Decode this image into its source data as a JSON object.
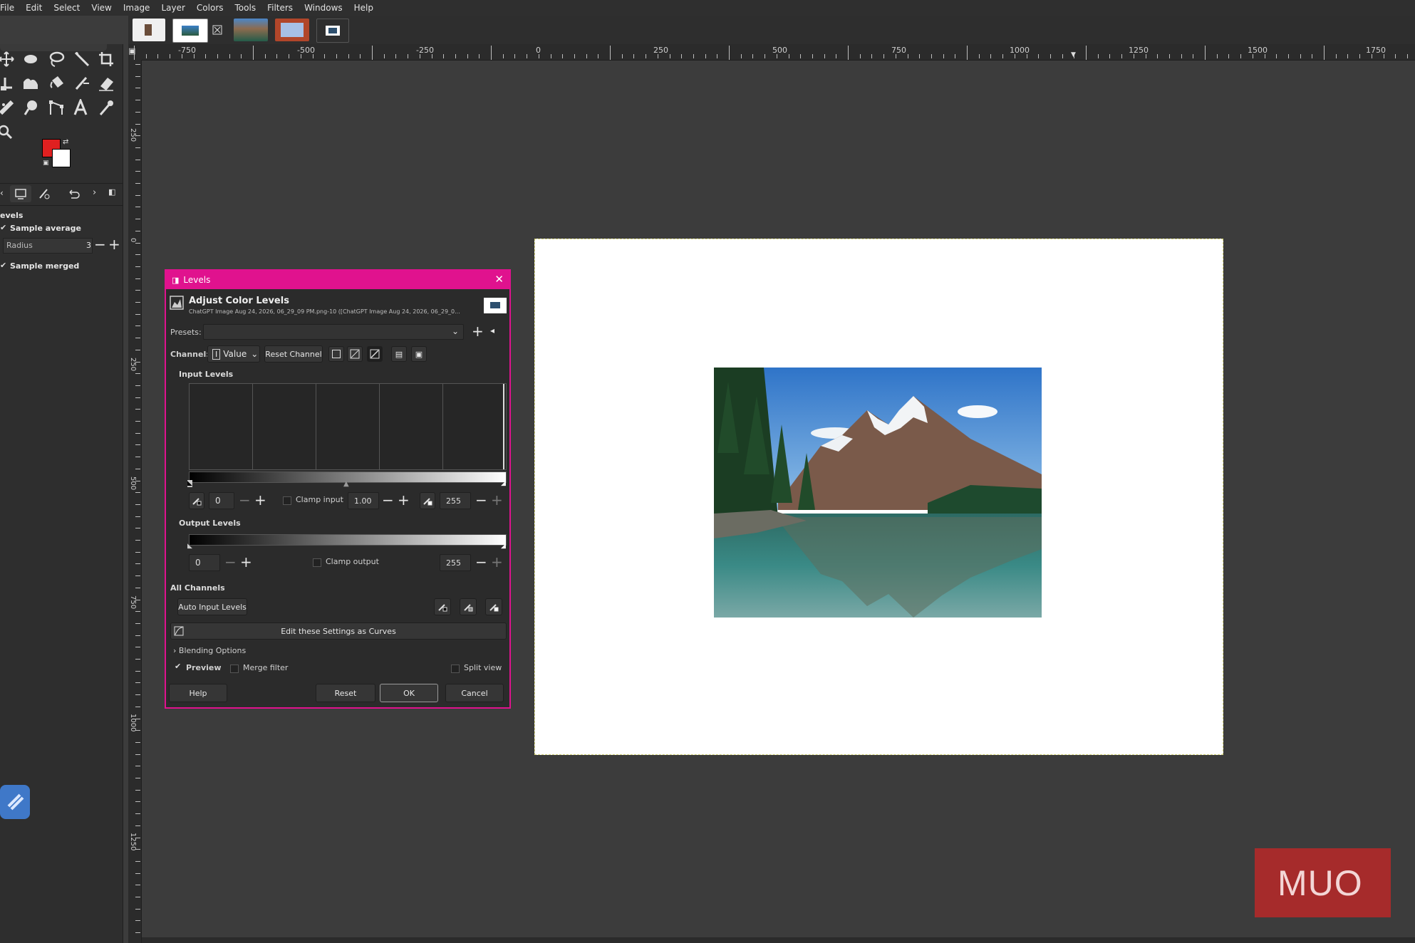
{
  "menu": [
    "File",
    "Edit",
    "Select",
    "View",
    "Image",
    "Layer",
    "Colors",
    "Tools",
    "Filters",
    "Windows",
    "Help"
  ],
  "image_tabs": [
    {
      "icon": "portrait-thumbnail-icon"
    },
    {
      "icon": "landscape-thumbnail-icon",
      "active": true
    },
    {
      "icon": "close-tab-icon"
    },
    {
      "icon": "mountain-lake-thumbnail-icon"
    },
    {
      "icon": "wide-thumbnail-icon"
    },
    {
      "icon": "small-thumbnail-icon"
    }
  ],
  "ruler": {
    "h_labels": [
      "-750",
      "-500",
      "-250",
      "0",
      "250",
      "500",
      "750",
      "1000",
      "1250",
      "1500",
      "1750"
    ],
    "v_labels": [
      "250",
      "0",
      "250",
      "500",
      "750",
      "1000",
      "1250"
    ]
  },
  "tool_options": {
    "title": "evels",
    "sample_average": "Sample average",
    "radius_label": "Radius",
    "radius_value": "3",
    "sample_merged": "Sample merged"
  },
  "colors": {
    "fg": "#e02020",
    "bg": "#ffffff",
    "accent": "#e0128e"
  },
  "dialog": {
    "window_title": "Levels",
    "heading": "Adjust Color Levels",
    "subtitle": "ChatGPT Image Aug 24, 2026, 06_29_09 PM.png-10 ([ChatGPT Image Aug 24, 2026, 06_29_0...",
    "presets_label": "Presets:",
    "channel_label": "Channel:",
    "channel_value": "Value",
    "reset_channel": "Reset Channel",
    "input_levels": "Input Levels",
    "input_low": "0",
    "clamp_input": "Clamp input",
    "gamma": "1.00",
    "input_high": "255",
    "output_levels": "Output Levels",
    "output_low": "0",
    "clamp_output": "Clamp output",
    "output_high": "255",
    "all_channels": "All Channels",
    "auto_input": "Auto Input Levels",
    "edit_curves": "Edit these Settings as Curves",
    "blending": "Blending Options",
    "preview": "Preview",
    "merge_filter": "Merge filter",
    "split_view": "Split view",
    "help": "Help",
    "reset": "Reset",
    "ok": "OK",
    "cancel": "Cancel"
  },
  "watermark": "MUO"
}
